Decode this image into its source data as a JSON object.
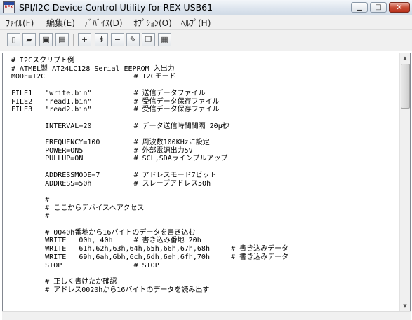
{
  "window": {
    "title": "SPI/I2C Device Control Utility for REX-USB61",
    "icon": "rex-app-icon",
    "controls": {
      "minimize": "minimize-icon",
      "maximize": "maximize-icon",
      "close": "close-icon"
    }
  },
  "menu": [
    {
      "label": "ﾌｧｲﾙ(F)"
    },
    {
      "label": "編集(E)"
    },
    {
      "label": "ﾃﾞﾊﾞｲｽ(D)"
    },
    {
      "label": "ｵﾌﾟｼｮﾝ(O)"
    },
    {
      "label": "ﾍﾙﾌﾟ(H)"
    }
  ],
  "toolbar": [
    {
      "icon": "new-file-icon"
    },
    {
      "icon": "open-folder-icon"
    },
    {
      "icon": "save-icon"
    },
    {
      "icon": "save-as-icon"
    },
    {
      "icon": "add-icon"
    },
    {
      "icon": "insert-icon"
    },
    {
      "icon": "remove-icon"
    },
    {
      "icon": "edit-icon"
    },
    {
      "icon": "copy-icon"
    },
    {
      "icon": "paste-icon"
    }
  ],
  "editor": {
    "lines": [
      "# I2Cスクリプト例",
      "# ATMEL製 AT24LC128 Serial EEPROM 入出力",
      "MODE=I2C                     # I2Cモード",
      "",
      "FILE1   \"write.bin\"          # 送信データファイル",
      "FILE2   \"read1.bin\"          # 受信データ保存ファイル",
      "FILE3   \"read2.bin\"          # 受信データ保存ファイル",
      "",
      "        INTERVAL=20          # データ送信時間間隔 20μ秒",
      "",
      "        FREQUENCY=100        # 周波数100KHzに設定",
      "        POWER=ON5            # 外部電源出力5V",
      "        PULLUP=ON            # SCL,SDAラインプルアップ",
      "",
      "        ADDRESSMODE=7        # アドレスモード7ビット",
      "        ADDRESS=50h          # スレーブアドレス50h",
      "",
      "        #",
      "        # ここからデバイスへアクセス",
      "        #",
      "",
      "        # 0040h番地から16バイトのデータを書き込む",
      "        WRITE   00h, 40h     # 書き込み番地 20h",
      "        WRITE   61h,62h,63h,64h,65h,66h,67h,68h     # 書き込みデータ",
      "        WRITE   69h,6ah,6bh,6ch,6dh,6eh,6fh,70h     # 書き込みデータ",
      "        STOP                 # STOP",
      "",
      "        # 正しく書けたか確認",
      "        # アドレス0020hから16バイトのデータを読み出す"
    ]
  }
}
